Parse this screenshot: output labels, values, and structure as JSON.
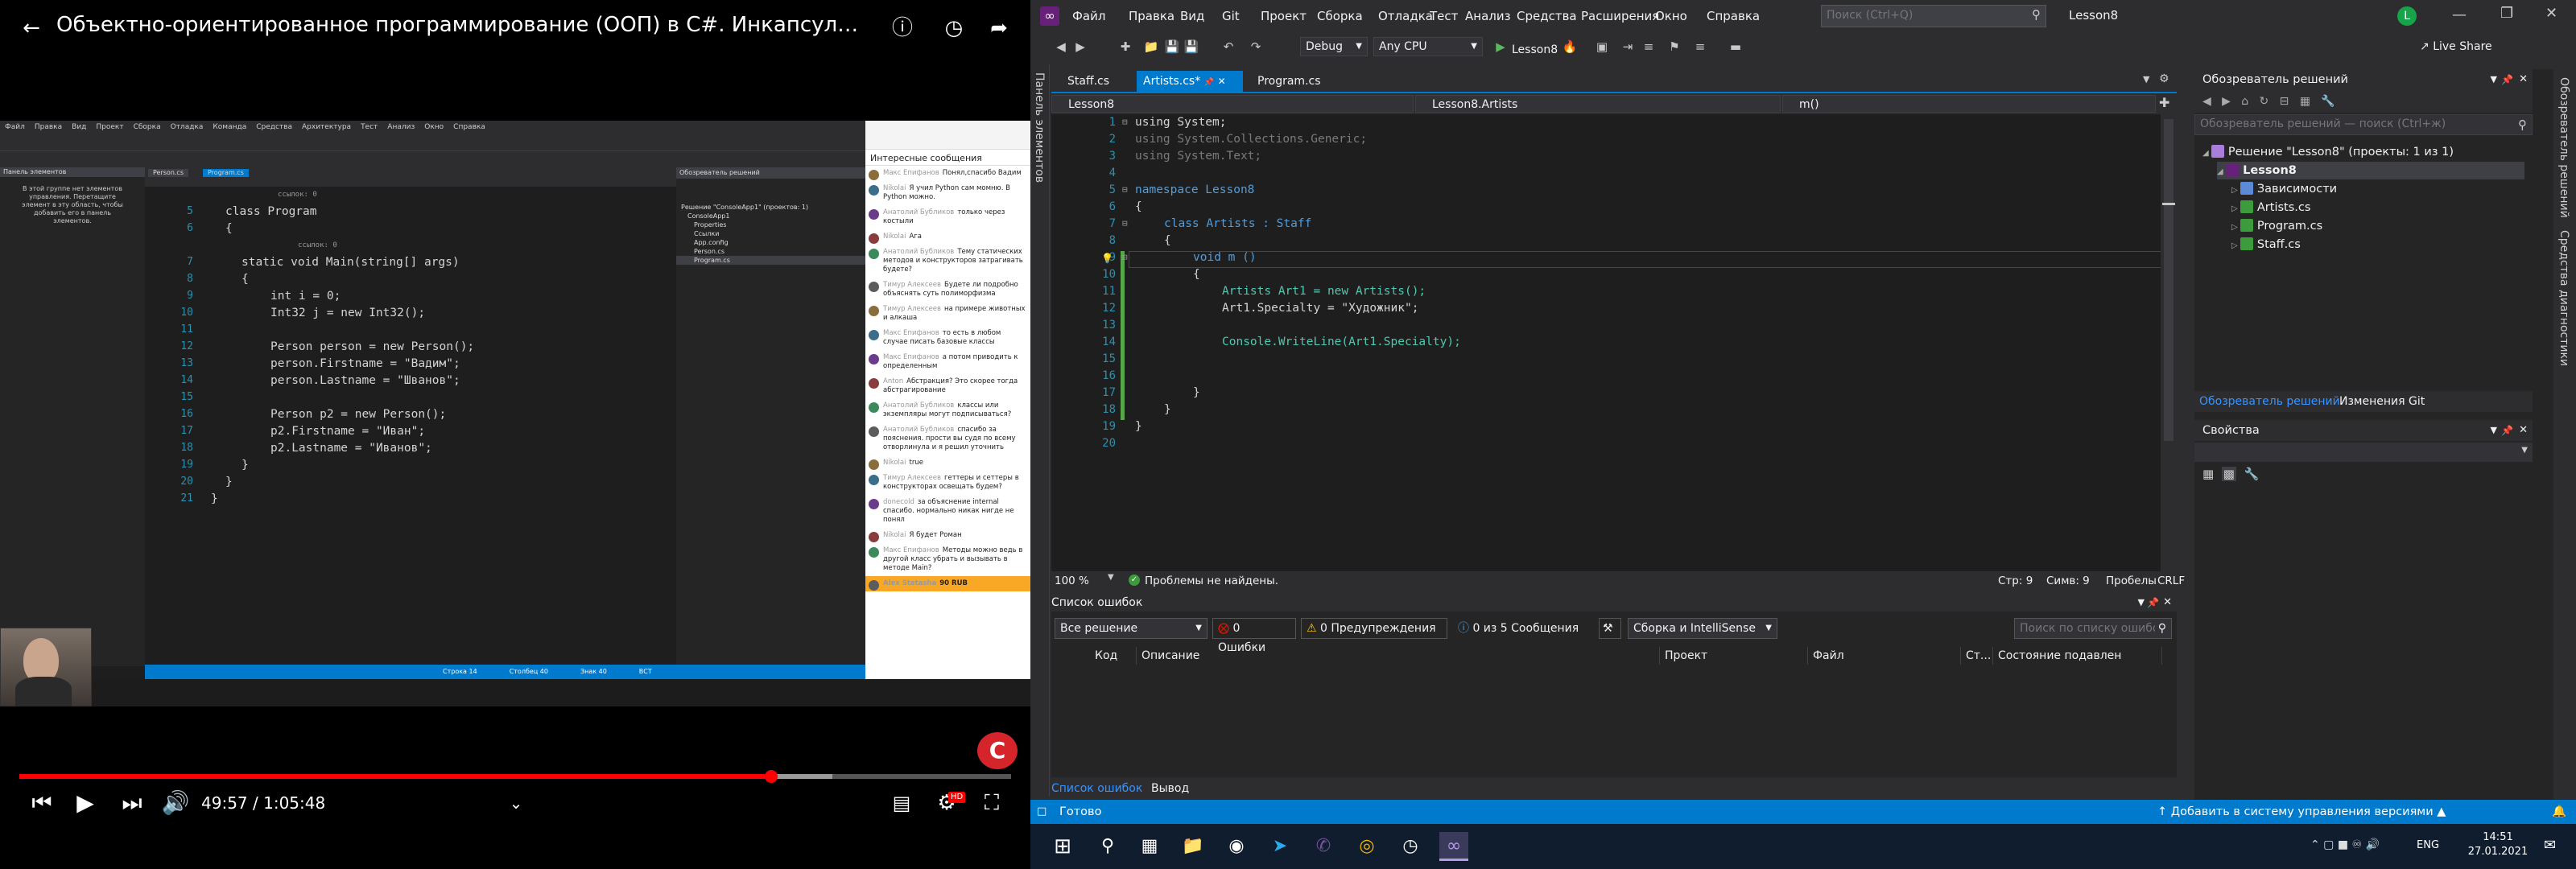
{
  "video": {
    "title": "Объектно-ориентированное программирование (ООП) в C#. Инкапсуляция, нас...",
    "time_current": "49:57",
    "time_sep": "/",
    "time_total": "1:05:48",
    "progress_fraction": 0.758,
    "buffered_fraction": 0.82,
    "watermark_letter": "C",
    "hd_badge": "HD",
    "inner_ide": {
      "menu": [
        "Файл",
        "Правка",
        "Вид",
        "Проект",
        "Сборка",
        "Отладка",
        "Команда",
        "Средства",
        "Архитектура",
        "Тест",
        "Анализ",
        "Окно",
        "Справка"
      ],
      "tabs": [
        "Person.cs",
        "Program.cs"
      ],
      "left_panel_title": "Панель элементов",
      "left_panel_text": "В этой группе нет элементов управления. Перетащите элемент в эту область, чтобы добавить его в панель элементов.",
      "code": [
        {
          "ln": "",
          "text": "ссылок: 0"
        },
        {
          "ln": "5",
          "text": "class Program"
        },
        {
          "ln": "6",
          "text": "{"
        },
        {
          "ln": "",
          "text": "ссылок: 0"
        },
        {
          "ln": "7",
          "text": "static void Main(string[] args)"
        },
        {
          "ln": "8",
          "text": "{"
        },
        {
          "ln": "9",
          "text": "int i = 0;"
        },
        {
          "ln": "10",
          "text": "Int32 j = new Int32();"
        },
        {
          "ln": "11",
          "text": ""
        },
        {
          "ln": "12",
          "text": "Person person = new Person();"
        },
        {
          "ln": "13",
          "text": "person.Firstname = \"Вадим\";"
        },
        {
          "ln": "14",
          "text": "person.Lastname = \"Шванов\";"
        },
        {
          "ln": "15",
          "text": ""
        },
        {
          "ln": "16",
          "text": "Person p2 = new Person();"
        },
        {
          "ln": "17",
          "text": "p2.Firstname = \"Иван\";"
        },
        {
          "ln": "18",
          "text": "p2.Lastname = \"Иванов\";"
        },
        {
          "ln": "19",
          "text": "}"
        },
        {
          "ln": "20",
          "text": "}"
        },
        {
          "ln": "21",
          "text": "}"
        }
      ],
      "solution_title": "Обозреватель решений",
      "solution_items": [
        "Решение \"ConsoleApp1\" (проектов: 1)",
        "ConsoleApp1",
        "Properties",
        "Ссылки",
        "App.config",
        "Person.cs",
        "Program.cs"
      ],
      "status": [
        "Строка 14",
        "Столбец 40",
        "Знак 40",
        "ВСТ"
      ],
      "chat_header": "Интересные сообщения",
      "chat": [
        {
          "who": "Макс Епифанов",
          "msg": "Понял,спасибо Вадим"
        },
        {
          "who": "Nikolai",
          "msg": "Я учил Python сам момню. В Python можно."
        },
        {
          "who": "Анатолий Бубликов",
          "msg": "только через костыли"
        },
        {
          "who": "Nikolai",
          "msg": "Ага"
        },
        {
          "who": "Анатолий Бубликов",
          "msg": "Тему статических методов и конструкторов затрагивать будете?"
        },
        {
          "who": "Тимур Алексеев",
          "msg": "Будете ли подробно объяснять суть полиморфизма"
        },
        {
          "who": "Тимур Алексеев",
          "msg": "на примере животных и алкаша"
        },
        {
          "who": "Макс Епифанов",
          "msg": "то есть в любом случае писать базовые классы"
        },
        {
          "who": "Макс Епифанов",
          "msg": "а потом приводить к определенным"
        },
        {
          "who": "Anton",
          "msg": "Абстракция? Это скорее тогда абстрагирование"
        },
        {
          "who": "Анатолий Бубликов",
          "msg": "классы или экземпляры могут подписываться?"
        },
        {
          "who": "Анатолий Бубликов",
          "msg": "спасибо за пояснения. прости вы судя по всему отворлинула и я решил уточнить"
        },
        {
          "who": "Nikolai",
          "msg": "true"
        },
        {
          "who": "Тимур Алексеев",
          "msg": "геттеры и сеттеры в конструкторах освещать будем?"
        },
        {
          "who": "donecold",
          "msg": "за объяснение internal спасибо. нормально никак нигде не понял"
        },
        {
          "who": "Nikolai",
          "msg": "Я будет Роман"
        },
        {
          "who": "Макс Епифанов",
          "msg": "Методы можно ведь в другой класс убрать и вызывать в методе Main?"
        },
        {
          "who": "Alex Statasha",
          "msg": "90 RUB"
        }
      ]
    }
  },
  "vs": {
    "menu": [
      "Файл",
      "Правка",
      "Вид",
      "Git",
      "Проект",
      "Сборка",
      "Отладка",
      "Тест",
      "Анализ",
      "Средства",
      "Расширения",
      "Окно",
      "Справка"
    ],
    "search_placeholder": "Поиск (Ctrl+Q)",
    "solution_name": "Lesson8",
    "user_initial": "L",
    "live_share": "Live Share",
    "config": "Debug",
    "platform": "Any CPU",
    "run_target": "Lesson8",
    "left_vertical_tab": "Панель элементов",
    "tabs": [
      {
        "label": "Staff.cs",
        "active": false
      },
      {
        "label": "Artists.cs*",
        "active": true
      },
      {
        "label": "Program.cs",
        "active": false
      }
    ],
    "nav": [
      "Lesson8",
      "Lesson8.Artists",
      "m()"
    ],
    "code_lines": [
      {
        "ln": "1",
        "text": "using System;"
      },
      {
        "ln": "2",
        "text": "using System.Collections.Generic;"
      },
      {
        "ln": "3",
        "text": "using System.Text;"
      },
      {
        "ln": "4",
        "text": ""
      },
      {
        "ln": "5",
        "text": "namespace Lesson8"
      },
      {
        "ln": "6",
        "text": "{"
      },
      {
        "ln": "7",
        "text": "class Artists : Staff"
      },
      {
        "ln": "8",
        "text": "{"
      },
      {
        "ln": "9",
        "text": "void m ()"
      },
      {
        "ln": "10",
        "text": "{"
      },
      {
        "ln": "11",
        "text": "Artists Art1 = new Artists();"
      },
      {
        "ln": "12",
        "text": "Art1.Specialty = \"Художник\";"
      },
      {
        "ln": "13",
        "text": ""
      },
      {
        "ln": "14",
        "text": "Console.WriteLine(Art1.Specialty);"
      },
      {
        "ln": "15",
        "text": ""
      },
      {
        "ln": "16",
        "text": ""
      },
      {
        "ln": "17",
        "text": "}"
      },
      {
        "ln": "18",
        "text": "}"
      },
      {
        "ln": "19",
        "text": "}"
      },
      {
        "ln": "20",
        "text": ""
      }
    ],
    "editor_status": {
      "zoom": "100 %",
      "issues": "Проблемы не найдены.",
      "line": "Стр: 9",
      "col": "Симв: 9",
      "spaces": "Пробелы",
      "eol": "CRLF"
    },
    "error_list": {
      "title": "Список ошибок",
      "scope": "Все решение",
      "errors": "0 Ошибки",
      "warnings": "0 Предупреждения",
      "messages": "0 из 5 Сообщения",
      "build_filter": "Сборка и IntelliSense",
      "search_placeholder": "Поиск по списку ошибок",
      "columns": [
        "Код",
        "Описание",
        "Проект",
        "Файл",
        "Ст...",
        "Состояние подавлен"
      ]
    },
    "bottom_tabs": [
      "Список ошибок",
      "Вывод"
    ],
    "solution_explorer": {
      "title": "Обозреватель решений",
      "search_placeholder": "Обозреватель решений — поиск (Ctrl+ж)",
      "items": [
        {
          "label": "Решение \"Lesson8\" (проекты: 1 из 1)",
          "indent": 0
        },
        {
          "label": "Lesson8",
          "indent": 1
        },
        {
          "label": "Зависимости",
          "indent": 2
        },
        {
          "label": "Artists.cs",
          "indent": 2
        },
        {
          "label": "Program.cs",
          "indent": 2
        },
        {
          "label": "Staff.cs",
          "indent": 2
        }
      ],
      "tab_se": "Обозреватель решений",
      "tab_git": "Изменения Git"
    },
    "properties_title": "Свойства",
    "right_vertical_tabs": [
      "Обозреватель решений",
      "Средства диагностики"
    ],
    "status": {
      "ready": "Готово",
      "vcs": "Добавить в систему управления версиями"
    },
    "colors": {
      "accent": "#007acc",
      "bg": "#2d2d30",
      "editor": "#1e1e1e"
    }
  },
  "taskbar": {
    "lang": "ENG",
    "time": "14:51",
    "date": "27.01.2021"
  }
}
